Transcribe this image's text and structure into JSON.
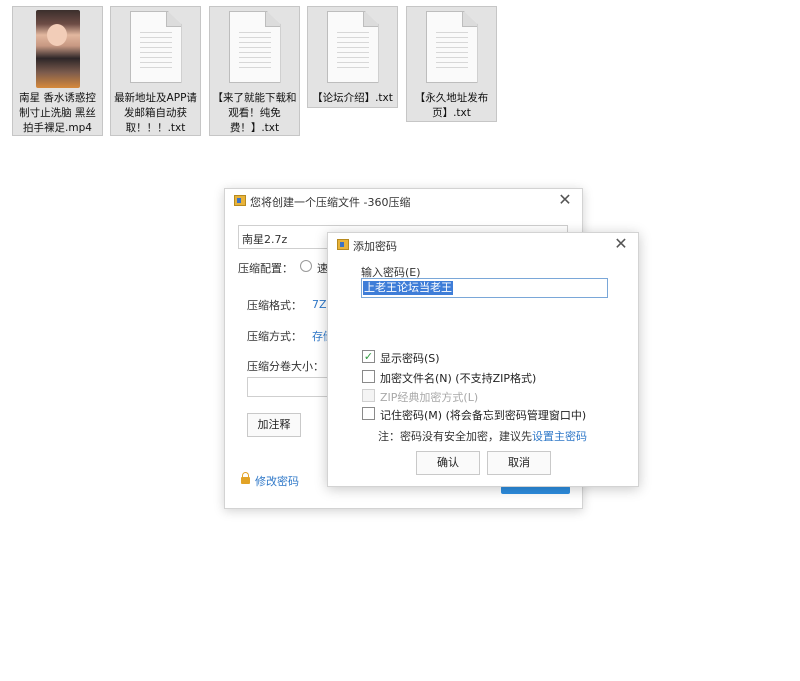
{
  "files": [
    {
      "name": "南星 香水诱惑控制寸止洗脑 黑丝拍手裸足.mp4",
      "type": "video",
      "icon": "video-thumbnail-icon"
    },
    {
      "name": "最新地址及APP请发邮箱自动获取！！！.txt",
      "type": "text",
      "icon": "text-file-icon"
    },
    {
      "name": "【来了就能下载和观看！纯免费！】.txt",
      "type": "text",
      "icon": "text-file-icon"
    },
    {
      "name": "【论坛介绍】.txt",
      "type": "text",
      "icon": "text-file-icon"
    },
    {
      "name": "【永久地址发布页】.txt",
      "type": "text",
      "icon": "text-file-icon"
    }
  ],
  "compress_window": {
    "title": "您将创建一个压缩文件 -360压缩",
    "filename": "南星2.7z",
    "config_label": "压缩配置：",
    "config_option": "速",
    "format_label": "压缩格式：",
    "format_value": "7Z",
    "method_label": "压缩方式：",
    "method_value": "存储",
    "split_label": "压缩分卷大小：",
    "split_value": "",
    "comment_button": "加注释",
    "change_password_link": "修改密码"
  },
  "password_dialog": {
    "title": "添加密码",
    "input_label": "输入密码(E)",
    "password_value": "上老王论坛当老王",
    "show_password_label": "显示密码(S)",
    "show_password_checked": true,
    "encrypt_filename_label": "加密文件名(N) (不支持ZIP格式)",
    "encrypt_filename_checked": false,
    "zip_classic_label": "ZIP经典加密方式(L)",
    "zip_classic_disabled": true,
    "remember_password_label": "记住密码(M) (将会备忘到密码管理窗口中)",
    "remember_password_checked": false,
    "note_text": "注：密码没有安全加密，建议先",
    "note_link": "设置主密码",
    "ok_button": "确认",
    "cancel_button": "取消"
  },
  "colors": {
    "accent": "#2f78c8",
    "primary_button": "#2e8ee0",
    "selection": "#3e7dd8",
    "check": "#2f9a3f",
    "lock": "#e2a326"
  }
}
